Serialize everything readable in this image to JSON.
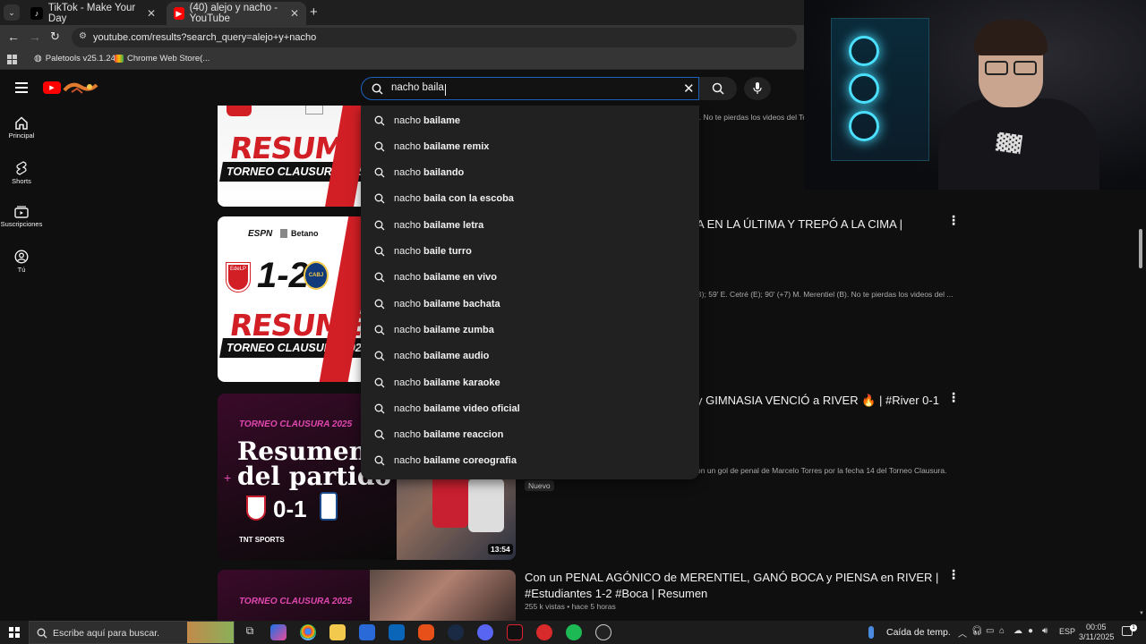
{
  "browser": {
    "tabs": [
      {
        "title": "TikTok - Make Your Day",
        "active": false
      },
      {
        "title": "(40) alejo y nacho - YouTube",
        "active": true
      }
    ],
    "url": "youtube.com/results?search_query=alejo+y+nacho",
    "bookmarks": [
      "Paletools v25.1.24",
      "Chrome Web Store(..."
    ]
  },
  "sidebar": [
    {
      "label": "Principal",
      "icon": "home-icon"
    },
    {
      "label": "Shorts",
      "icon": "shorts-icon"
    },
    {
      "label": "Suscripciones",
      "icon": "subscriptions-icon"
    },
    {
      "label": "Tú",
      "icon": "you-icon"
    }
  ],
  "search": {
    "query": "nacho baila",
    "suggestions": [
      {
        "prefix": "nacho ",
        "bold": "bailame"
      },
      {
        "prefix": "nacho ",
        "bold": "bailame remix"
      },
      {
        "prefix": "nacho ",
        "bold": "bailando"
      },
      {
        "prefix": "nacho ",
        "bold": "baila con la escoba"
      },
      {
        "prefix": "nacho ",
        "bold": "bailame letra"
      },
      {
        "prefix": "nacho ",
        "bold": "baile turro"
      },
      {
        "prefix": "nacho ",
        "bold": "bailame en vivo"
      },
      {
        "prefix": "nacho ",
        "bold": "bailame bachata"
      },
      {
        "prefix": "nacho ",
        "bold": "bailame zumba"
      },
      {
        "prefix": "nacho ",
        "bold": "bailame audio"
      },
      {
        "prefix": "nacho ",
        "bold": "bailame karaoke"
      },
      {
        "prefix": "nacho ",
        "bold": "bailame video oficial"
      },
      {
        "prefix": "nacho ",
        "bold": "bailame reaccion"
      },
      {
        "prefix": "nacho ",
        "bold": "bailame coreografia"
      }
    ]
  },
  "results": [
    {
      "thumb_main": "RESUMEN",
      "thumb_sub": "TORNEO CLAUSURA 2025",
      "desc": "). No te pierdas los videos del Tor"
    },
    {
      "thumb_top_left": "ESPN",
      "thumb_top_right": "Betano",
      "thumb_score": "1-2",
      "thumb_badge_left": "EdeLP",
      "thumb_badge_right": "CABJ",
      "thumb_main": "RESUMEN",
      "thumb_sub": "TORNEO CLAUSURA 2025",
      "title_fragment": "A EN LA ÚLTIMA Y TREPÓ A LA CIMA |",
      "desc": "B); 59' E. Cetré (E); 90' (+7) M. Merentiel (B). No te pierdas los videos del ..."
    },
    {
      "thumb_label": "TORNEO CLAUSURA 2025",
      "thumb_main1": "Resumen",
      "thumb_main2": "del partido",
      "thumb_score": "0-1",
      "thumb_brand": "TNT SPORTS",
      "duration": "13:54",
      "title_fragment": "y GIMNASIA VENCIÓ a RIVER 🔥 | #River 0-1",
      "desc": "on un gol de penal de Marcelo Torres por la fecha 14 del Torneo Clausura.",
      "badge": "Nuevo"
    },
    {
      "thumb_label": "TORNEO CLAUSURA 2025",
      "title_line1": "Con un PENAL AGÓNICO de MERENTIEL, GANÓ BOCA y PIENSA en RIVER |",
      "title_line2": "#Estudiantes 1-2 #Boca | Resumen",
      "meta": "255 k vistas • hace 5 horas"
    }
  ],
  "taskbar": {
    "search_placeholder": "Escribe aquí para buscar.",
    "weather": "Caída de temp.",
    "lang": "ESP",
    "time": "00:05",
    "date": "3/11/2025"
  },
  "colors": {
    "brand": "#ff0000",
    "search_border": "#1c62b9"
  }
}
